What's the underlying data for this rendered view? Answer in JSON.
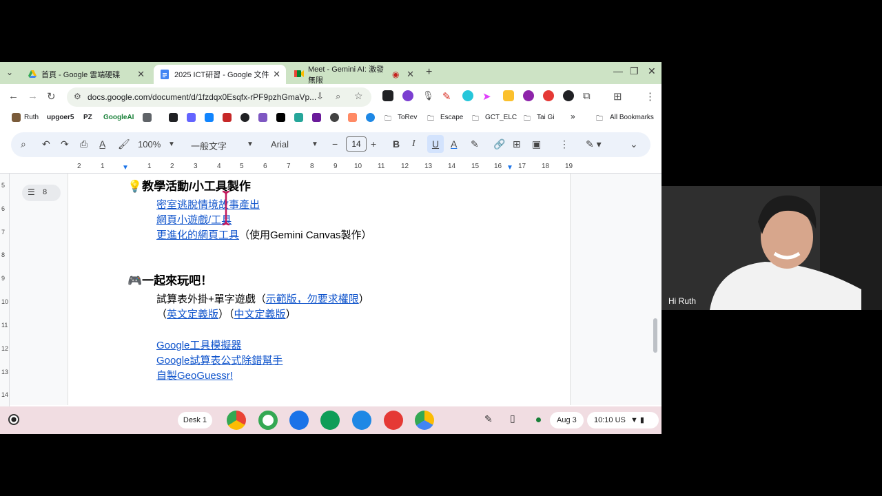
{
  "tabs": [
    {
      "title": "首頁 - Google 雲端硬碟",
      "active": false
    },
    {
      "title": "2025 ICT研習 - Google 文件",
      "active": true
    },
    {
      "title": "Meet - Gemini AI: 激發無限",
      "active": false
    }
  ],
  "address": {
    "url": "docs.google.com/document/d/1fzdqx0Esqfx-rPF9pzhGmaVp..."
  },
  "bookmarks": [
    "Ruth",
    "upgoer5",
    "PZ",
    "GoogleAI",
    "ToRev",
    "Escape",
    "GCT_ELC",
    "Tai Gi",
    "All Bookmarks"
  ],
  "toolbar": {
    "zoom": "100%",
    "style": "一般文字",
    "font": "Arial",
    "size": "14"
  },
  "ruler": {
    "numbers": [
      "2",
      "1",
      "1",
      "2",
      "3",
      "4",
      "5",
      "6",
      "7",
      "8",
      "9",
      "10",
      "11",
      "12",
      "13",
      "14",
      "15",
      "16",
      "17",
      "18",
      "19"
    ],
    "vnumbers": [
      "5",
      "6",
      "7",
      "8",
      "9",
      "10",
      "11",
      "12",
      "13",
      "14"
    ]
  },
  "outline": {
    "count": "8"
  },
  "doc": {
    "heading1": "教學活動/小工具製作",
    "link1": "密室逃脫情境故事產出",
    "link2": "網頁小遊戲/工具",
    "link3": "更進化的網頁工具",
    "line3_suffix": "（使用Gemini Canvas製作）",
    "heading2": "一起來玩吧！",
    "line4_prefix": "試算表外掛+單字遊戲（",
    "link4": "示範版，勿要求權限",
    "line4_suffix": "）",
    "line5_a": "（",
    "link5": "英文定義版",
    "line5_b": "）（",
    "link6": "中文定義版",
    "line5_c": "）",
    "link7": "Google工具模擬器",
    "link8": "Google試算表公式除錯幫手",
    "link9": "自製GeoGuessr!"
  },
  "shelf": {
    "desk": "Desk 1",
    "date": "Aug 3",
    "time": "10:10",
    "locale": "US"
  },
  "video": {
    "name": "Hi Ruth"
  }
}
